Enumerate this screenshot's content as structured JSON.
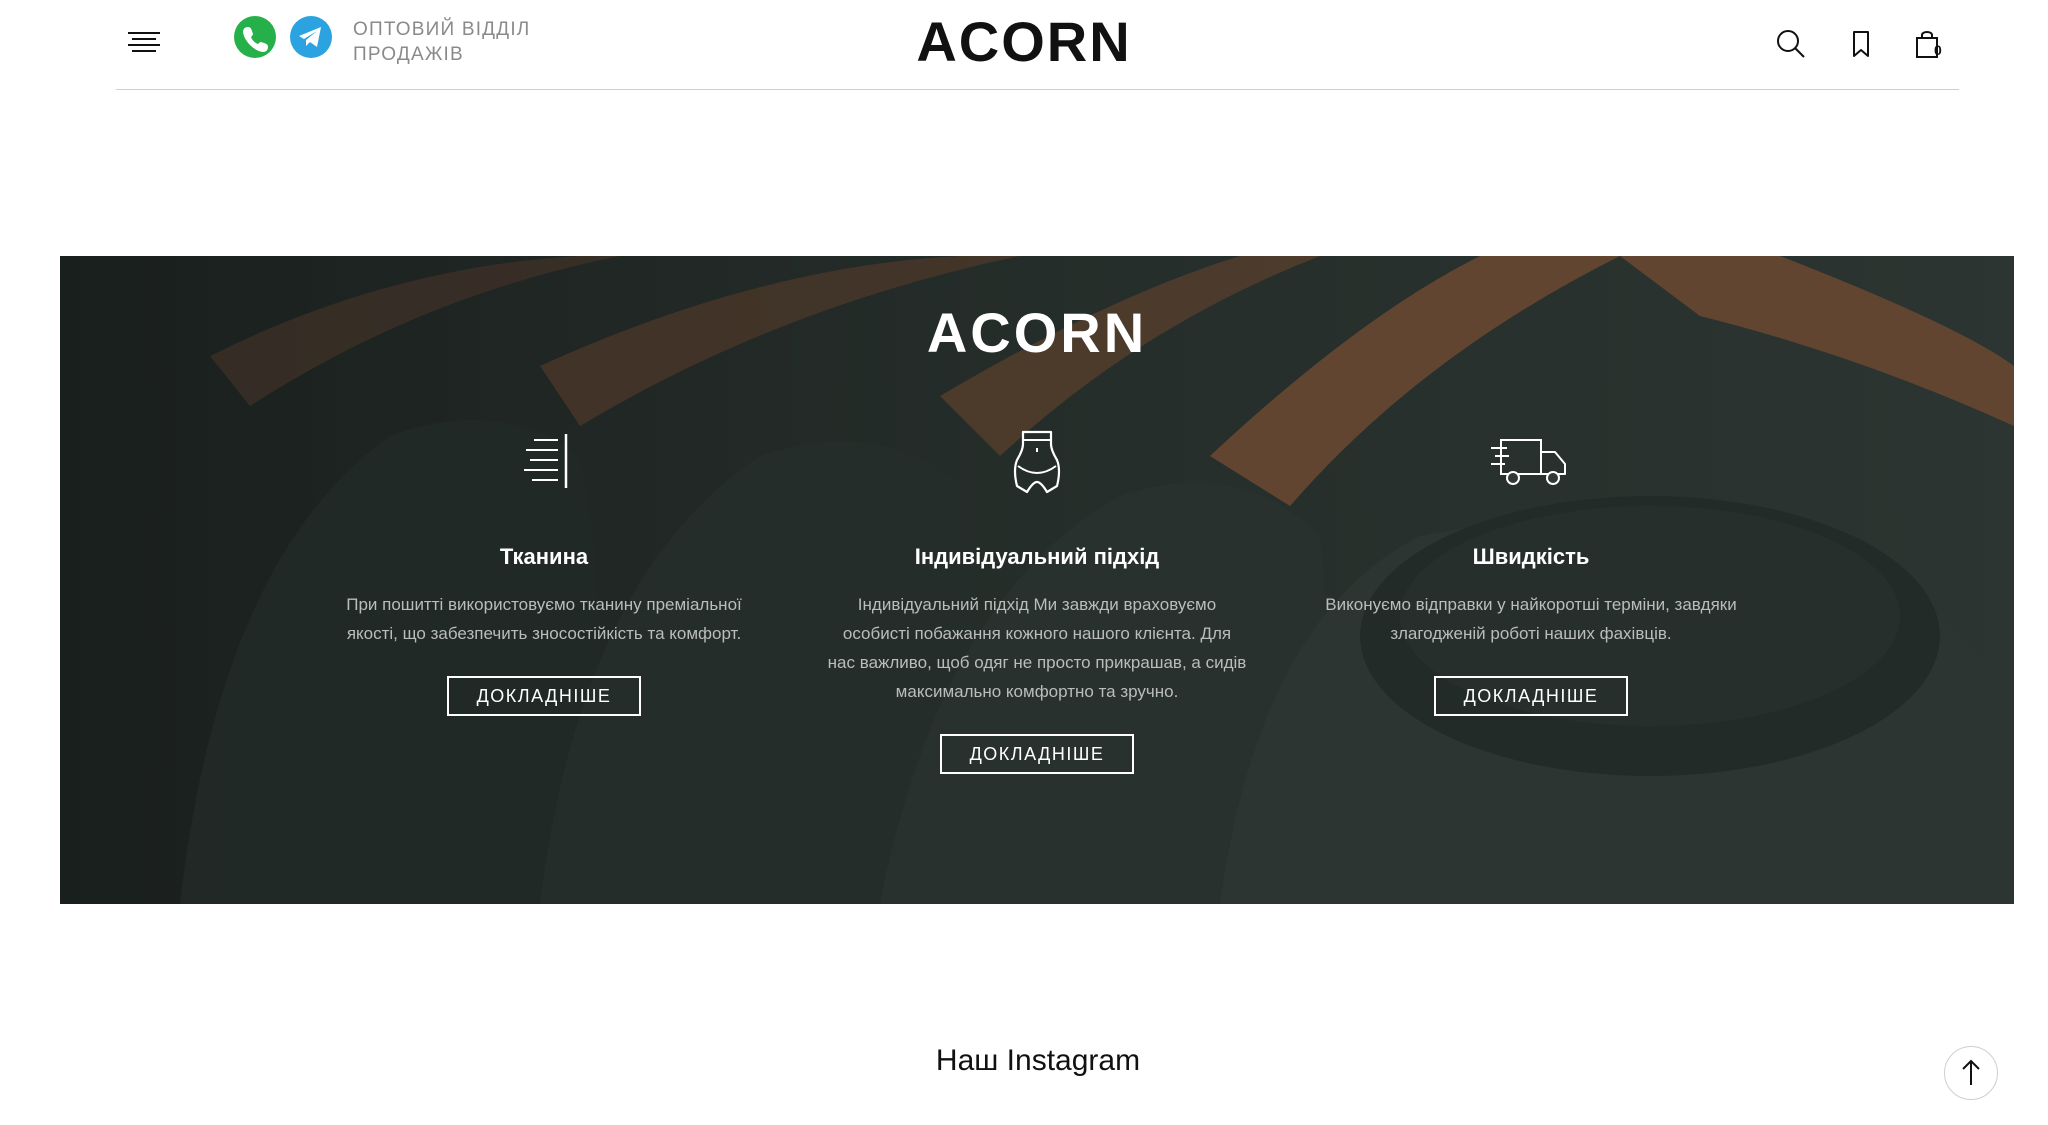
{
  "header": {
    "wholesale_line1": "ОПТОВИЙ ВІДДІЛ",
    "wholesale_line2": "ПРОДАЖІВ",
    "logo": "ACORN",
    "cart_count": "0",
    "icons": [
      "menu-icon",
      "phone-icon",
      "telegram-icon",
      "search-icon",
      "bookmark-icon",
      "cart-icon"
    ]
  },
  "banner": {
    "logo": "ACORN",
    "features": [
      {
        "icon": "fabric-icon",
        "title": "Тканина",
        "text": "При пошитті використовуємо тканину преміальної якості, що забезпечить зносостійкість та комфорт.",
        "button": "ДОКЛАДНІШЕ"
      },
      {
        "icon": "body-fit-icon",
        "title": "Індивідуальний підхід",
        "text": "Індивідуальний підхід Ми завжди враховуємо особисті побажання кожного нашого клієнта. Для нас важливо, щоб одяг не просто прикрашав, а сидів максимально комфортно та зручно.",
        "button": "ДОКЛАДНІШЕ"
      },
      {
        "icon": "delivery-truck-icon",
        "title": "Швидкість",
        "text": "Виконуємо відправки у найкоротші терміни, завдяки злагодженій роботі наших фахівців.",
        "button": "ДОКЛАДНІШЕ"
      }
    ]
  },
  "instagram": {
    "title": "Наш Instagram"
  },
  "colors": {
    "phone": "#25b04a",
    "telegram": "#2aa3e0",
    "banner_bg": "#26302c",
    "text_muted": "#8a8a8a"
  }
}
